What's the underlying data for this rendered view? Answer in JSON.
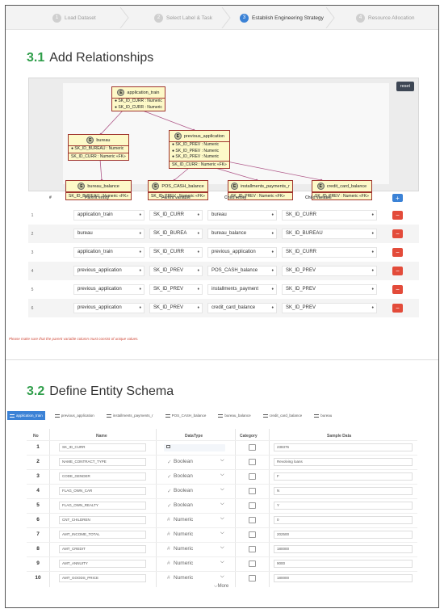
{
  "steps": [
    {
      "num": "1",
      "label": "Load Dataset"
    },
    {
      "num": "2",
      "label": "Select Label & Task"
    },
    {
      "num": "3",
      "label": "Establish Engineering Strategy"
    },
    {
      "num": "4",
      "label": "Resource Allocation"
    }
  ],
  "section1": {
    "num": "3.1",
    "title": "Add Relationships"
  },
  "diagram": {
    "reset_label": "reset",
    "entities": [
      {
        "name": "application_train",
        "attrs": [
          "SK_ID_CURR : Numeric",
          "SK_ID_CURR : Numeric"
        ],
        "fk": ""
      },
      {
        "name": "bureau",
        "attrs": [
          "SK_ID_BUREAU : Numeric"
        ],
        "fk": "SK_ID_CURR : Numeric «FK»"
      },
      {
        "name": "previous_application",
        "attrs": [
          "SK_ID_PREV : Numeric",
          "SK_ID_PREV : Numeric",
          "SK_ID_PREV : Numeric"
        ],
        "fk": "SK_ID_CURR : Numeric «FK»"
      },
      {
        "name": "bureau_balance",
        "attrs": [],
        "fk": "SK_ID_BUREAU : Numeric «FK»"
      },
      {
        "name": "POS_CASH_balance",
        "attrs": [],
        "fk": "SK_ID_PREV : Numeric «FK»"
      },
      {
        "name": "installments_payments_r",
        "attrs": [],
        "fk": "SK_ID_PREV : Numeric «FK»"
      },
      {
        "name": "credit_card_balance",
        "attrs": [],
        "fk": "SK_ID_PREV : Numeric «FK»"
      }
    ]
  },
  "relationships": {
    "headers": [
      "#",
      "Parent entity",
      "Parent variable",
      "Child entity",
      "Child variable"
    ],
    "add_label": "+",
    "remove_label": "−",
    "rows": [
      {
        "num": "1",
        "parent": "application_train",
        "pvar": "SK_ID_CURR",
        "child": "bureau",
        "cvar": "SK_ID_CURR"
      },
      {
        "num": "2",
        "parent": "bureau",
        "pvar": "SK_ID_BUREA",
        "child": "bureau_balance",
        "cvar": "SK_ID_BUREAU"
      },
      {
        "num": "3",
        "parent": "application_train",
        "pvar": "SK_ID_CURR",
        "child": "previous_application",
        "cvar": "SK_ID_CURR"
      },
      {
        "num": "4",
        "parent": "previous_application",
        "pvar": "SK_ID_PREV",
        "child": "POS_CASH_balance",
        "cvar": "SK_ID_PREV"
      },
      {
        "num": "5",
        "parent": "previous_application",
        "pvar": "SK_ID_PREV",
        "child": "installments_payment",
        "cvar": "SK_ID_PREV"
      },
      {
        "num": "6",
        "parent": "previous_application",
        "pvar": "SK_ID_PREV",
        "child": "credit_card_balance",
        "cvar": "SK_ID_PREV"
      }
    ],
    "note": "Please make sure that the parent variable column must consist of unique values."
  },
  "section2": {
    "num": "3.2",
    "title": "Define Entity Schema"
  },
  "schema_tabs": [
    "application_train",
    "previous_application",
    "installments_payments_r",
    "POS_CASH_balance",
    "bureau_balance",
    "credit_card_balance",
    "bureau"
  ],
  "schema": {
    "headers": [
      "No",
      "Name",
      "DataType",
      "Category",
      "Sample Data"
    ],
    "rows": [
      {
        "no": "1",
        "name": "SK_ID_CURR",
        "dtype": "",
        "icon": "",
        "sample": "238376"
      },
      {
        "no": "2",
        "name": "NAME_CONTRACT_TYPE",
        "dtype": "Boolean",
        "icon": "✓",
        "sample": "Revolving loans"
      },
      {
        "no": "3",
        "name": "CODE_GENDER",
        "dtype": "Boolean",
        "icon": "✓",
        "sample": "F"
      },
      {
        "no": "4",
        "name": "FLAG_OWN_CAR",
        "dtype": "Boolean",
        "icon": "✓",
        "sample": "N"
      },
      {
        "no": "5",
        "name": "FLAG_OWN_REALTY",
        "dtype": "Boolean",
        "icon": "✓",
        "sample": "Y"
      },
      {
        "no": "6",
        "name": "CNT_CHILDREN",
        "dtype": "Numeric",
        "icon": "#",
        "sample": "0"
      },
      {
        "no": "7",
        "name": "AMT_INCOME_TOTAL",
        "dtype": "Numeric",
        "icon": "#",
        "sample": "202500"
      },
      {
        "no": "8",
        "name": "AMT_CREDIT",
        "dtype": "Numeric",
        "icon": "#",
        "sample": "180000"
      },
      {
        "no": "9",
        "name": "AMT_ANNUITY",
        "dtype": "Numeric",
        "icon": "#",
        "sample": "9000"
      },
      {
        "no": "10",
        "name": "AMT_GOODS_PRICE",
        "dtype": "Numeric",
        "icon": "#",
        "sample": "180000"
      }
    ],
    "more_label": "More"
  }
}
